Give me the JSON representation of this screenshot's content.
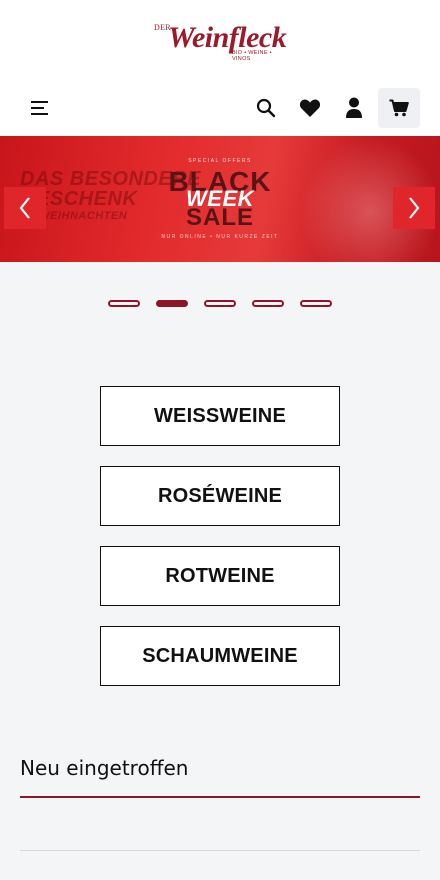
{
  "header": {
    "logo": {
      "prefix": "DER",
      "name": "Weinfleck",
      "tagline": "BIO • WEINE • VINOS"
    },
    "icons": {
      "menu": "menu-icon",
      "search": "search-icon",
      "wishlist": "heart-icon",
      "account": "user-icon",
      "cart": "cart-icon"
    }
  },
  "banner": {
    "bg_line1": "DAS BESONDERE",
    "bg_line2": "GESCHENK",
    "bg_line3": "ZU WEIHNACHTEN",
    "special": "SPECIAL OFFERS",
    "word1": "BLACK",
    "word2": "WEEK",
    "word3": "SALE",
    "limited": "NUR ONLINE • NUR KURZE ZEIT",
    "slide_count": 5,
    "active_slide": 2
  },
  "categories": [
    {
      "label": "WEISSWEINE"
    },
    {
      "label": "ROSÉWEINE"
    },
    {
      "label": "ROTWEINE"
    },
    {
      "label": "SCHAUMWEINE"
    }
  ],
  "new_arrivals": {
    "title": "Neu eingetroffen"
  },
  "colors": {
    "brand": "#9b1b2a",
    "accent_red": "#e0262b",
    "dot": "#8e1528"
  }
}
